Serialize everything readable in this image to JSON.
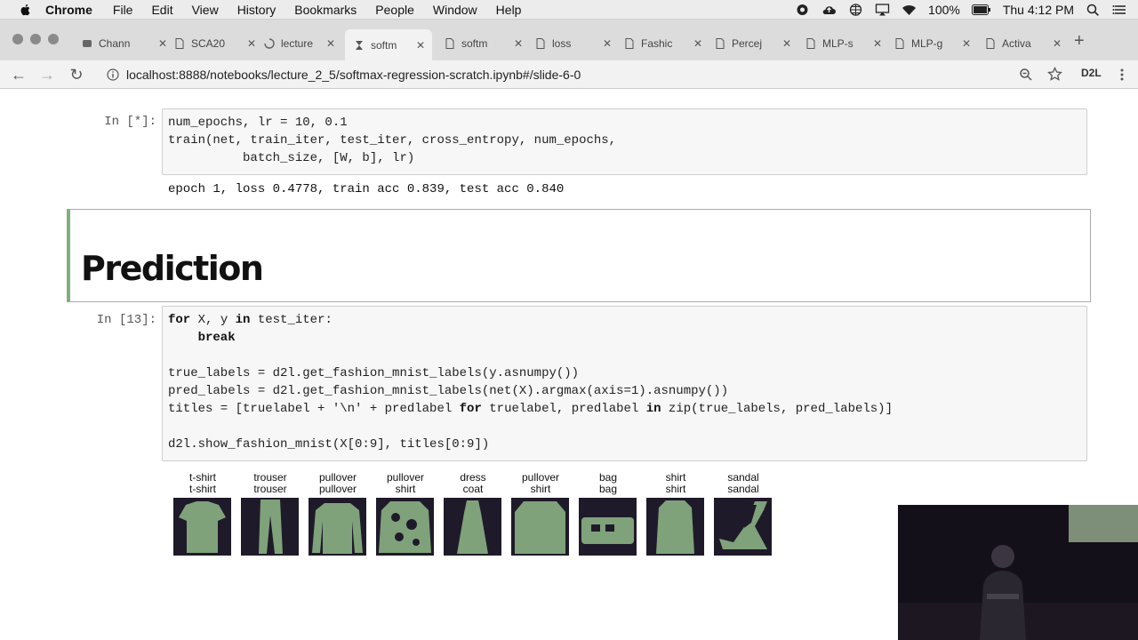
{
  "menubar": {
    "app": "Chrome",
    "items": [
      "File",
      "Edit",
      "View",
      "History",
      "Bookmarks",
      "People",
      "Window",
      "Help"
    ],
    "battery": "100%",
    "clock": "Thu 4:12 PM"
  },
  "tabs": [
    {
      "label": "Chann",
      "icon": "tab-favicon"
    },
    {
      "label": "SCA20",
      "icon": "doc-icon"
    },
    {
      "label": "lecture",
      "icon": "loading-icon"
    },
    {
      "label": "softm",
      "icon": "jupyter-icon",
      "active": true
    },
    {
      "label": "softm",
      "icon": "doc-icon"
    },
    {
      "label": "loss",
      "icon": "doc-icon"
    },
    {
      "label": "Fashic",
      "icon": "doc-icon"
    },
    {
      "label": "Percej",
      "icon": "doc-icon"
    },
    {
      "label": "MLP-s",
      "icon": "doc-icon"
    },
    {
      "label": "MLP-g",
      "icon": "doc-icon"
    },
    {
      "label": "Activa",
      "icon": "doc-icon"
    }
  ],
  "address": {
    "url": "localhost:8888/notebooks/lecture_2_5/softmax-regression-scratch.ipynb#/slide-6-0",
    "extension_label": "D2L"
  },
  "cells": {
    "cell1": {
      "prompt": "In [*]:",
      "lines": [
        "num_epochs, lr = 10, 0.1",
        "train(net, train_iter, test_iter, cross_entropy, num_epochs,",
        "          batch_size, [W, b], lr)"
      ],
      "output": "epoch 1, loss 0.4778, train acc 0.839, test acc 0.840"
    },
    "markdown": {
      "heading": "Prediction"
    },
    "cell2": {
      "prompt": "In [13]:",
      "line1_kw1": "for",
      "line1_mid": " X, y ",
      "line1_kw2": "in",
      "line1_end": " test_iter:",
      "line2_kw": "    break",
      "line3": "true_labels = d2l.get_fashion_mnist_labels(y.asnumpy())",
      "line4": "pred_labels = d2l.get_fashion_mnist_labels(net(X).argmax(axis=1).asnumpy())",
      "line5_a": "titles = [truelabel + '\\n' + predlabel ",
      "line5_kw1": "for",
      "line5_b": " truelabel, predlabel ",
      "line5_kw2": "in",
      "line5_c": " zip(true_labels, pred_labels)]",
      "line6": "d2l.show_fashion_mnist(X[0:9], titles[0:9])"
    }
  },
  "figure": [
    {
      "true": "t-shirt",
      "pred": "t-shirt"
    },
    {
      "true": "trouser",
      "pred": "trouser"
    },
    {
      "true": "pullover",
      "pred": "pullover"
    },
    {
      "true": "pullover",
      "pred": "shirt"
    },
    {
      "true": "dress",
      "pred": "coat"
    },
    {
      "true": "pullover",
      "pred": "shirt"
    },
    {
      "true": "bag",
      "pred": "bag"
    },
    {
      "true": "shirt",
      "pred": "shirt"
    },
    {
      "true": "sandal",
      "pred": "sandal"
    }
  ],
  "colors": {
    "thumb_bg": "#1f1a2a",
    "thumb_fg": "#7fa27a",
    "md_border": "#7fae7f"
  }
}
